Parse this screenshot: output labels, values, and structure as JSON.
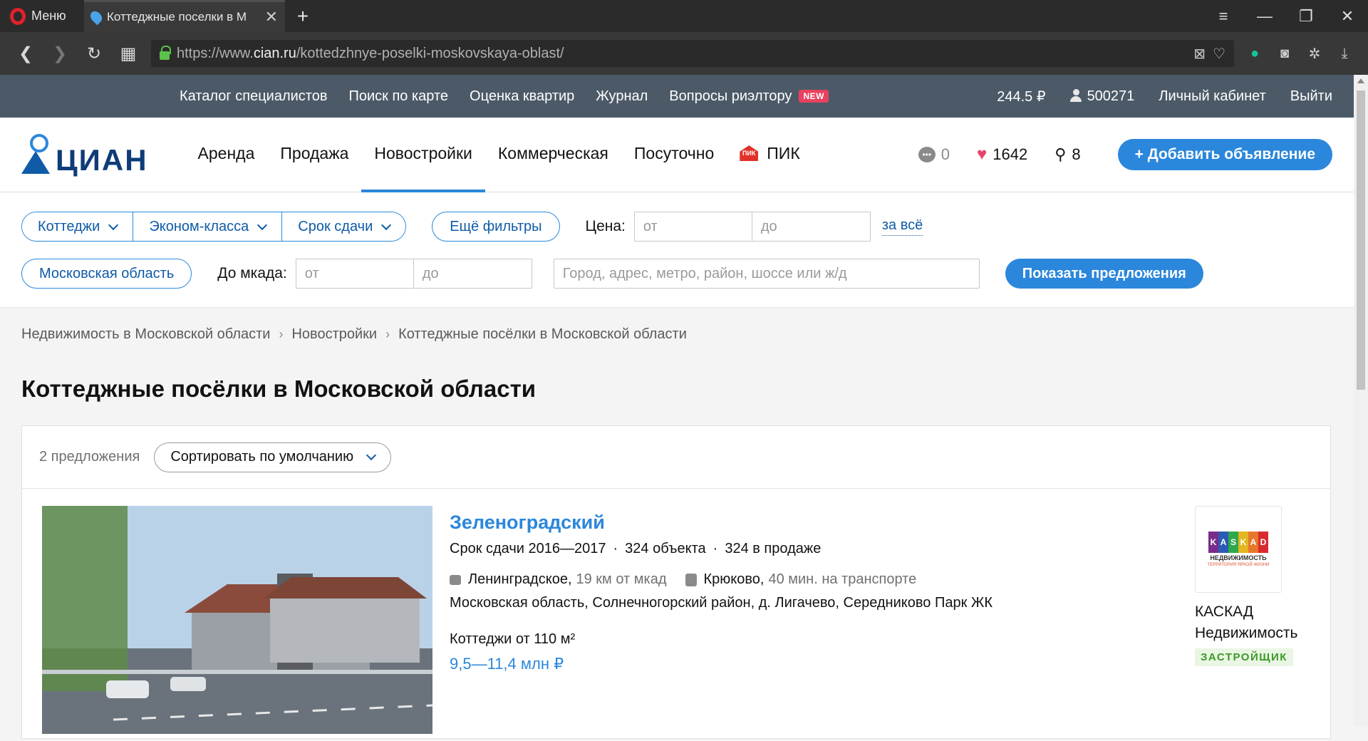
{
  "browser": {
    "menu_label": "Меню",
    "tab_title": "Коттеджные поселки в М",
    "url_prefix": "https://www.",
    "url_domain": "cian.ru",
    "url_path": "/kottedzhnye-poselki-moskovskaya-oblast/"
  },
  "topbar": {
    "links": [
      "Каталог специалистов",
      "Поиск по карте",
      "Оценка квартир",
      "Журнал",
      "Вопросы риэлтору"
    ],
    "new_badge": "NEW",
    "balance": "244.5 ₽",
    "user_id": "500271",
    "cabinet": "Личный кабинет",
    "logout": "Выйти"
  },
  "header": {
    "logo": "ЦИАН",
    "nav": [
      "Аренда",
      "Продажа",
      "Новостройки",
      "Коммерческая",
      "Посуточно",
      "ПИК"
    ],
    "pik_badge": "ПИК",
    "messages": "0",
    "favorites": "1642",
    "notifications": "8",
    "add_button": "+ Добавить объявление"
  },
  "filters": {
    "type": "Коттеджи",
    "class": "Эконом-класса",
    "deadline": "Срок сдачи",
    "more": "Ещё фильтры",
    "price_label": "Цена:",
    "price_from": "от",
    "price_to": "до",
    "price_unit": "за всё",
    "region": "Московская область",
    "mkad_label": "До мкада:",
    "mkad_from": "от",
    "mkad_to": "до",
    "address_placeholder": "Город, адрес, метро, район, шоссе или ж/д",
    "show_button": "Показать предложения"
  },
  "breadcrumbs": [
    "Недвижимость в Московской области",
    "Новостройки",
    "Коттеджные посёлки в Московской области"
  ],
  "page_title": "Коттеджные посёлки в Московской области",
  "listing": {
    "count": "2 предложения",
    "sort": "Сортировать по умолчанию",
    "card": {
      "title": "Зеленоградский",
      "deadline": "Срок сдачи 2016—2017",
      "objects": "324 объекта",
      "on_sale": "324 в продаже",
      "highway": "Ленинградское,",
      "highway_dist": "19 км от мкад",
      "station": "Крюково,",
      "station_time": "40 мин. на транспорте",
      "address": "Московская область, Солнечногорский район, д. Лигачево, Середниково Парк ЖК",
      "area": "Коттеджи от 110 м²",
      "price": "9,5—11,4 млн ₽",
      "developer_logo_letters": [
        "K",
        "A",
        "S",
        "K",
        "A",
        "D"
      ],
      "developer_logo_sub": "НЕДВИЖИМОСТЬ",
      "developer_logo_tagline": "ТЕРРИТОРИЯ ЯРКОЙ ЖИЗНИ",
      "developer_name_1": "КАСКАД",
      "developer_name_2": "Недвижимость",
      "developer_tag": "ЗАСТРОЙЩИК"
    }
  },
  "colors": {
    "brand": "#2b87db",
    "topbar": "#4c5a68",
    "badge": "#e84260"
  }
}
